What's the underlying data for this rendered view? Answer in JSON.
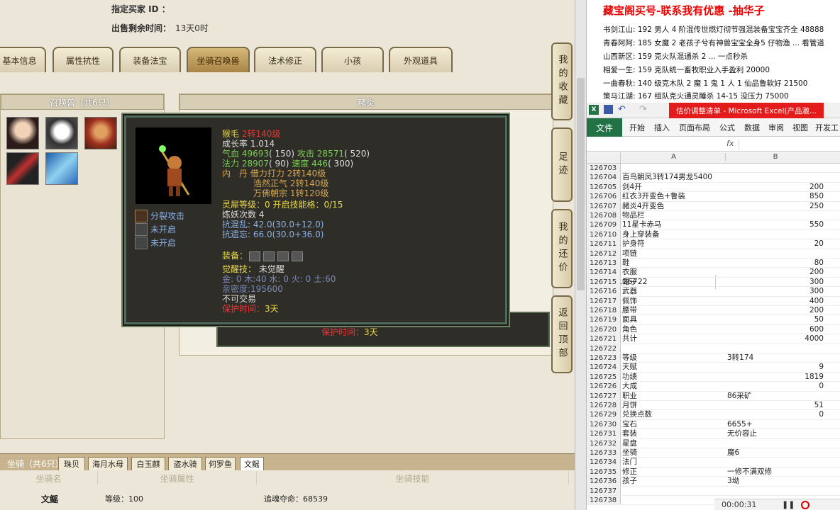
{
  "info": {
    "buyer_label": "指定买家 ID ：",
    "buyer_value": "",
    "time_label": "出售剩余时间：",
    "time_value": "13天0时"
  },
  "tabs": [
    "基本信息",
    "属性抗性",
    "装备法宝",
    "坐骑召唤兽",
    "法术修正",
    "小孩",
    "外观道具"
  ],
  "pet_list_title": "召唤兽（共6只）",
  "pet_detail_title": "赭炎",
  "side_buttons": [
    "我的收藏",
    "足迹",
    "我的还价",
    "返回顶部"
  ],
  "tooltip": {
    "name": "猴毛",
    "name_level": "2转140级",
    "growth": "成长率 1.014",
    "hp_label": "气血",
    "hp_value": "49693",
    "hp_extra": "( 150)",
    "atk_label": "攻击",
    "atk_value": "28571",
    "atk_extra": "( 520)",
    "mp_label": "法力",
    "mp_value": "28907",
    "mp_extra": "( 90)",
    "spd_label": "速度",
    "spd_value": "446",
    "spd_extra": "( 300)",
    "neidan_label": "内　丹",
    "neidan": [
      "借力打力 2转140级",
      "浩然正气 2转140级",
      "万佛朝宗 1转120级"
    ],
    "lingxi": "灵犀等级：0 开启技能格：0/15",
    "lianyao": "炼妖次数 4",
    "resist1": "抗混乱: 42.0(30.0+12.0)",
    "resist2": "抗遗忘: 66.0(30.0+36.0)",
    "equip_label": "装备：",
    "awaken_label": "觉醒技：",
    "awaken_value": "未觉醒",
    "elements": "金: 0 木:40 水: 0 火: 0 土:60",
    "intimacy": "亲密度:195600",
    "untradeable": "不可交易",
    "protect_label": "保护时间：",
    "protect_value": "3天",
    "skills": [
      "分裂攻击",
      "未开启",
      "未开启"
    ]
  },
  "tooltip2": {
    "protect_label": "保护时间：",
    "protect_value": "3天"
  },
  "mount": {
    "title": "坐骑（共6只）",
    "tabs": [
      "珠贝",
      "海月水母",
      "白玉麒",
      "盗水骑",
      "何罗鱼",
      "文鳐"
    ],
    "headers": [
      "坐骑名",
      "坐骑属性",
      "坐骑技能"
    ],
    "row": {
      "name": "文鳐",
      "level": "等级：100",
      "skill": "追魂夺命：68539"
    }
  },
  "promo": {
    "title": "藏宝阁买号-联系我有优惠 -抽华子",
    "lines": [
      "书剑江山: 192 男人 4 阶混传世燃灯彻节强混装备宝宝齐全 48888",
      "青春阿阿: 185 女魔 2 老孩子兮有神兽宝宝全身5 仔物渔 ... 看管道",
      "山西新区: 159 克火队混通杀 2 ... 一点秒杀",
      "相爱一生: 159 克队统一畜牧职业入手盈利 20000",
      "一曲春秋: 140 级克木队 2 魔 1 鬼 1 人 1 仙品鲁软好 21500",
      "策马江湖: 167 组队克火通灵睡杀 14-15 没压力 75000"
    ]
  },
  "excel": {
    "window_title": "估价调整清单 - Microsoft Excel(产品激...",
    "ribbon": [
      "文件",
      "开始",
      "插入",
      "页面布局",
      "公式",
      "数据",
      "审阅",
      "视图",
      "开发工"
    ],
    "namebox": "C126722",
    "fx": "fx",
    "col_a": "A",
    "col_b": "B",
    "rows": [
      [
        "126703",
        "",
        ""
      ],
      [
        "126704",
        "百鸟朝凤3转174男龙5400",
        ""
      ],
      [
        "126705",
        "剑4开",
        "200"
      ],
      [
        "126706",
        "红衣3开变色+鲁装",
        "850"
      ],
      [
        "126707",
        "赭炎4开变色",
        "250"
      ],
      [
        "126708",
        "物品栏",
        ""
      ],
      [
        "126709",
        "11星卡赤马",
        "550"
      ],
      [
        "126710",
        "身上穿装备",
        ""
      ],
      [
        "126711",
        "护身符",
        "20"
      ],
      [
        "126712",
        "项链",
        ""
      ],
      [
        "126713",
        "鞋",
        "80"
      ],
      [
        "126714",
        "衣服",
        "200"
      ],
      [
        "126715",
        "帽子",
        "300"
      ],
      [
        "126716",
        "武器",
        "300"
      ],
      [
        "126717",
        "佩饰",
        "400"
      ],
      [
        "126718",
        "腰带",
        "200"
      ],
      [
        "126719",
        "面具",
        "50"
      ],
      [
        "126720",
        "角色",
        "600"
      ],
      [
        "126721",
        "共计",
        "4000"
      ],
      [
        "126722",
        "",
        ""
      ],
      [
        "126723",
        "等级",
        "3转174"
      ],
      [
        "126724",
        "天赋",
        "9"
      ],
      [
        "126725",
        "功绩",
        "1819"
      ],
      [
        "126726",
        "大成",
        "0"
      ],
      [
        "126727",
        "职业",
        "86采矿"
      ],
      [
        "126728",
        "月饼",
        "51"
      ],
      [
        "126729",
        "兑换点数",
        "0"
      ],
      [
        "126730",
        "宝石",
        "6655+"
      ],
      [
        "126731",
        "套装",
        "无价容止"
      ],
      [
        "126732",
        "星盘",
        ""
      ],
      [
        "126733",
        "坐骑",
        "魔6"
      ],
      [
        "126734",
        "法门",
        ""
      ],
      [
        "126735",
        "修正",
        "一修不满双修"
      ],
      [
        "126736",
        "孩子",
        "3坳"
      ],
      [
        "126737",
        "",
        ""
      ],
      [
        "126738",
        "",
        ""
      ]
    ],
    "recorder": "00:00:31"
  }
}
